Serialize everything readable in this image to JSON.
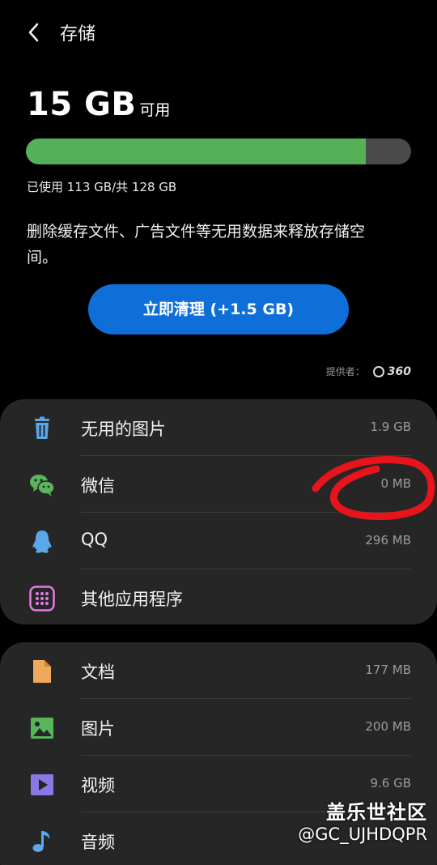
{
  "header": {
    "title": "存储"
  },
  "storage": {
    "available_value": "15 GB",
    "available_label": "可用",
    "used_text": "已使用 113 GB/共 128 GB",
    "used_fraction": 0.883,
    "description": "删除缓存文件、广告文件等无用数据来释放存储空间。",
    "clean_button_label": "立即清理 (+1.5 GB)"
  },
  "provider": {
    "label": "提供者：",
    "brand": "360"
  },
  "apps_section": {
    "items": [
      {
        "label": "无用的图片",
        "size": "1.9 GB",
        "icon": "trash-icon"
      },
      {
        "label": "微信",
        "size": "0 MB",
        "icon": "wechat-icon"
      },
      {
        "label": "QQ",
        "size": "296 MB",
        "icon": "qq-icon"
      },
      {
        "label": "其他应用程序",
        "size": "",
        "icon": "apps-grid-icon"
      }
    ]
  },
  "files_section": {
    "items": [
      {
        "label": "文档",
        "size": "177 MB",
        "icon": "document-icon"
      },
      {
        "label": "图片",
        "size": "200 MB",
        "icon": "image-icon"
      },
      {
        "label": "视频",
        "size": "9.6 GB",
        "icon": "video-icon"
      },
      {
        "label": "音频",
        "size": "",
        "icon": "music-icon"
      }
    ]
  },
  "watermark": {
    "title": "盖乐世社区",
    "user": "@GC_UJHDQPR"
  },
  "colors": {
    "background": "#000000",
    "card": "#262626",
    "bar_fill": "#55b157",
    "bar_track": "#4a4a4a",
    "primary_button": "#0f6fd8",
    "annotation": "#e8141c"
  }
}
